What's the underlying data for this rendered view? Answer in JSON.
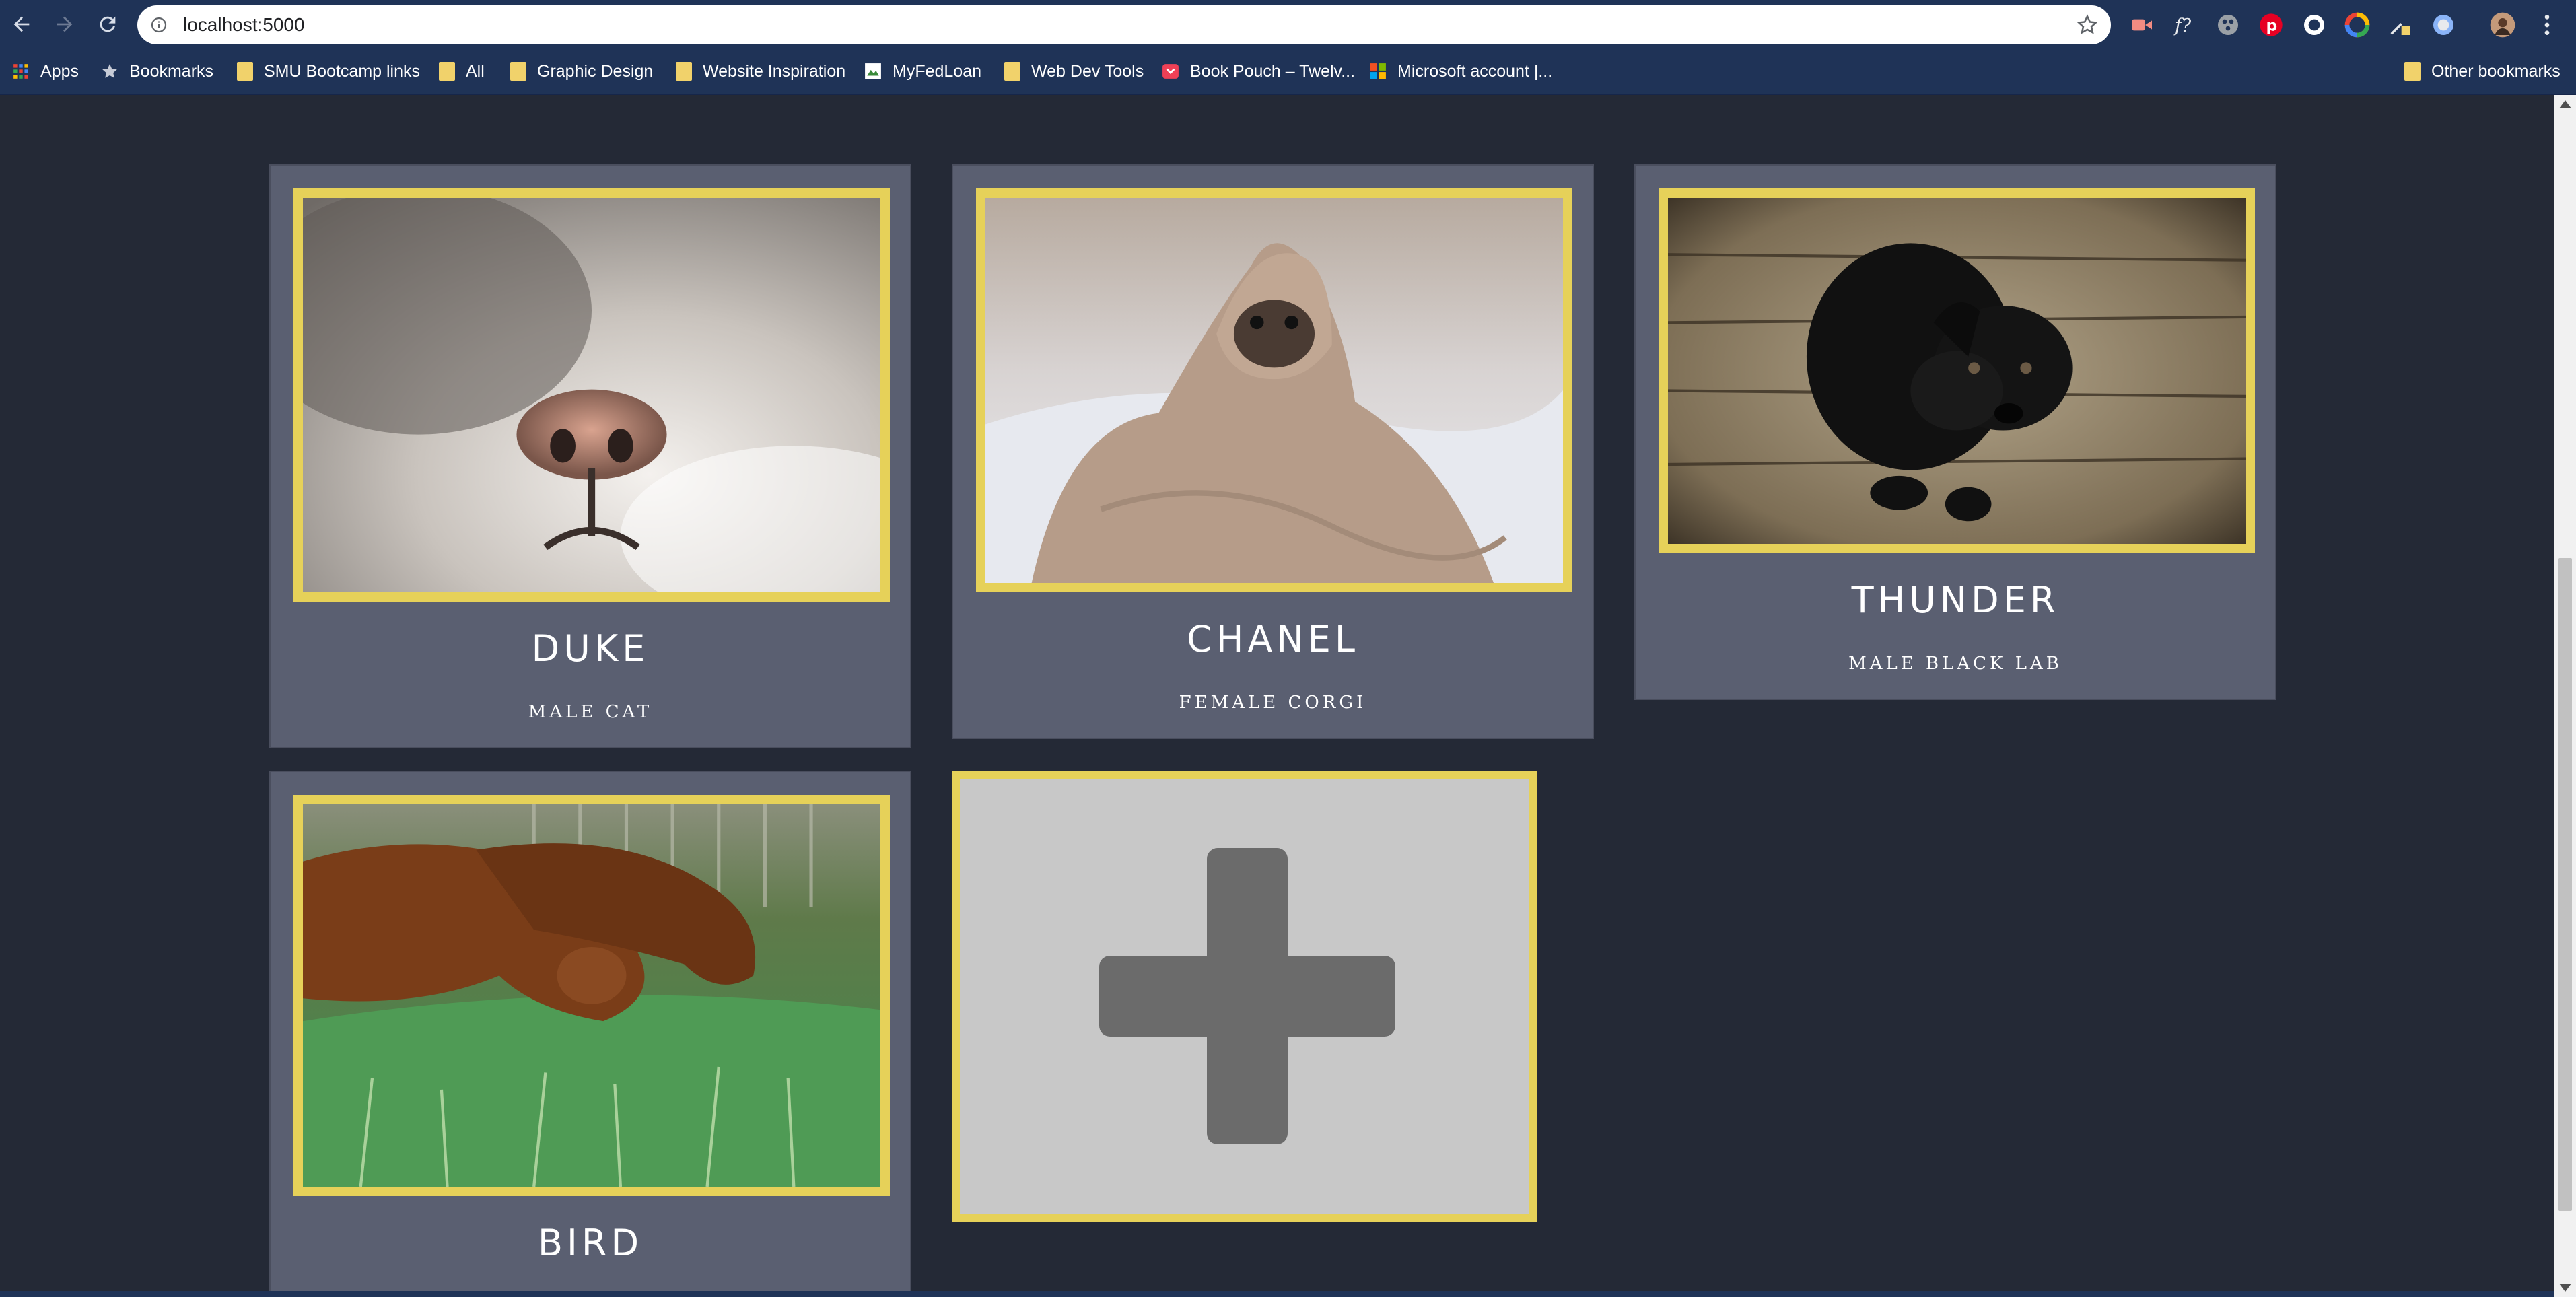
{
  "browser": {
    "url": "localhost:5000",
    "bookmarks": [
      {
        "label": "Apps",
        "icon": "apps-grid-icon"
      },
      {
        "label": "Bookmarks",
        "icon": "star-icon"
      },
      {
        "label": "SMU Bootcamp links",
        "icon": "folder-icon"
      },
      {
        "label": "All",
        "icon": "folder-icon"
      },
      {
        "label": "Graphic Design",
        "icon": "folder-icon"
      },
      {
        "label": "Website Inspiration",
        "icon": "folder-icon"
      },
      {
        "label": "MyFedLoan",
        "icon": "myfedloan-icon"
      },
      {
        "label": "Web Dev Tools",
        "icon": "folder-icon"
      },
      {
        "label": "Book Pouch – Twelv...",
        "icon": "pocket-icon"
      },
      {
        "label": "Microsoft account |...",
        "icon": "microsoft-icon"
      }
    ],
    "other_bookmarks": "Other bookmarks"
  },
  "pets": [
    {
      "name": "DUKE",
      "description": "MALE CAT",
      "photo": "cat-nose-photo"
    },
    {
      "name": "CHANEL",
      "description": "FEMALE CORGI",
      "photo": "pug-in-blanket-photo"
    },
    {
      "name": "THUNDER",
      "description": "MALE BLACK LAB",
      "photo": "black-lab-puppy-photo"
    },
    {
      "name": "BIRD",
      "description": "",
      "photo": "dachshunds-on-grass-photo"
    }
  ],
  "colors": {
    "page_bg": "#242936",
    "card_bg": "#5a5f71",
    "photo_border": "#e6d159",
    "add_card_bg": "#c8c8c8",
    "plus_color": "#6b6b6b",
    "chrome_bg": "#1f3357"
  }
}
